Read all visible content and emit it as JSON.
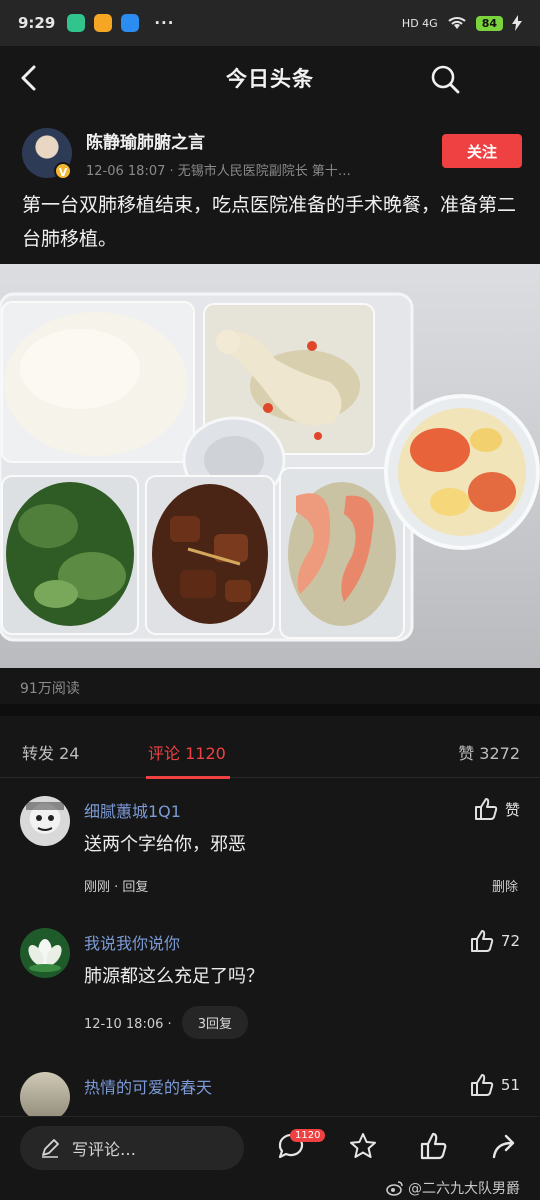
{
  "status_bar": {
    "time": "9:29",
    "dots": "···",
    "network": "HD 4G",
    "battery": "84",
    "app_icon_colors": [
      "#31c48d",
      "#f5a623",
      "#2b8cf2"
    ]
  },
  "header": {
    "title": "今日头条"
  },
  "author": {
    "name": "陈静瑜肺腑之言",
    "meta": "12-06 18:07 · 无锡市人民医院副院长 第十…",
    "verified_badge": "V",
    "follow_label": "关注"
  },
  "post": {
    "text": "第一台双肺移植结束，吃点医院准备的手术晚餐，准备第二台肺移植。",
    "reads": "91万阅读"
  },
  "tabs": {
    "repost": "转发 24",
    "comments": "评论 1120",
    "likes": "赞 3272"
  },
  "comments": [
    {
      "name": "细腻蕙城1Q1",
      "text": "送两个字给你，邪恶",
      "time_reply": "刚刚 · 回复",
      "like_label": "赞",
      "delete_label": "删除"
    },
    {
      "name": "我说我你说你",
      "text": "肺源都这么充足了吗？",
      "time": "12-10 18:06 ·",
      "reply_count": "3回复",
      "like_count": "72"
    },
    {
      "name": "热情的可爱的春天",
      "text": "",
      "like_count": "51"
    }
  ],
  "bottom_bar": {
    "write_placeholder": "写评论…",
    "comment_badge": "1120"
  },
  "watermark": "@二六九大队男爵",
  "colors": {
    "accent": "#f04142",
    "username": "#7b9ad6",
    "background": "#161616"
  }
}
